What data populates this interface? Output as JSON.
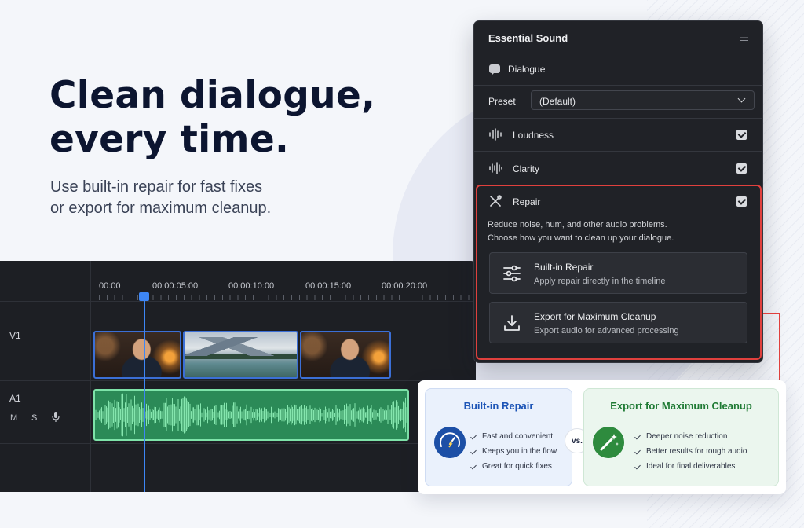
{
  "hero": {
    "title_line1": "Clean dialogue,",
    "title_line2": "every time.",
    "subtitle_line1": "Use built-in repair for fast fixes",
    "subtitle_line2": "or export for maximum cleanup."
  },
  "timeline": {
    "timecodes": [
      "00:00",
      "00:00:05:00",
      "00:00:10:00",
      "00:00:15:00",
      "00:00:20:00"
    ],
    "video_track_label": "V1",
    "audio_track_label": "A1",
    "mute_label": "M",
    "solo_label": "S",
    "clips": [
      "talking-head",
      "mountain-lake",
      "talking-head"
    ],
    "colors": {
      "playhead": "#3d86f5",
      "audio_clip": "#2b8a57",
      "waveform": "#8ff0b8"
    }
  },
  "panel": {
    "title": "Essential Sound",
    "category": "Dialogue",
    "preset_label": "Preset",
    "preset_value": "(Default)",
    "sections": [
      {
        "label": "Loudness",
        "icon": "waveform-icon",
        "checked": true
      },
      {
        "label": "Clarity",
        "icon": "waveform-icon",
        "checked": true
      },
      {
        "label": "Repair",
        "icon": "tools-icon",
        "checked": true
      }
    ],
    "repair_desc_line1": "Reduce noise, hum, and other audio problems.",
    "repair_desc_line2": "Choose how you want to clean up your dialogue.",
    "options": [
      {
        "title": "Built-in Repair",
        "subtitle": "Apply repair directly in the timeline",
        "icon": "sliders-icon"
      },
      {
        "title": "Export for Maximum Cleanup",
        "subtitle": "Export audio for advanced processing",
        "icon": "download-icon"
      }
    ],
    "colors": {
      "highlight": "#e0403d"
    }
  },
  "compare": {
    "left": {
      "title": "Built-in Repair",
      "icon": "speedometer-icon",
      "items": [
        "Fast and convenient",
        "Keeps you in the flow",
        "Great for quick fixes"
      ]
    },
    "vs": "vs.",
    "right": {
      "title": "Export for Maximum Cleanup",
      "icon": "magic-wand-icon",
      "items": [
        "Deeper noise reduction",
        "Better results for tough audio",
        "Ideal for final deliverables"
      ]
    },
    "colors": {
      "left_accent": "#1c4fa6",
      "right_accent": "#2e8b3e"
    }
  }
}
